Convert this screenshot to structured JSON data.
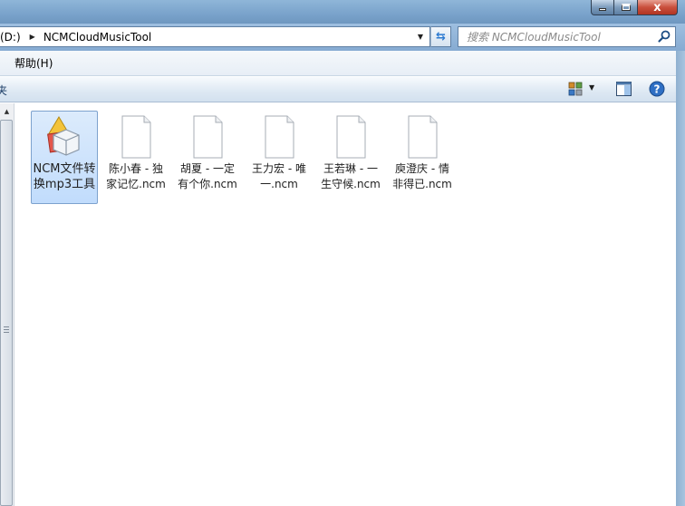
{
  "window": {
    "minimize_label": "",
    "maximize_label": "",
    "close_label": "x"
  },
  "address": {
    "drive": "(D:)",
    "folder": "NCMCloudMusicTool"
  },
  "search": {
    "placeholder": "搜索 NCMCloudMusicTool"
  },
  "menu": {
    "help": "帮助(H)"
  },
  "command": {
    "clipped_label": "夹"
  },
  "files": [
    {
      "label": "NCM文件转换mp3工具",
      "icon": "application-icon",
      "selected": true
    },
    {
      "label": "陈小春 - 独家记忆.ncm",
      "icon": "blank-file-icon",
      "selected": false
    },
    {
      "label": "胡夏 - 一定有个你.ncm",
      "icon": "blank-file-icon",
      "selected": false
    },
    {
      "label": "王力宏 - 唯一.ncm",
      "icon": "blank-file-icon",
      "selected": false
    },
    {
      "label": "王若琳 - 一生守候.ncm",
      "icon": "blank-file-icon",
      "selected": false
    },
    {
      "label": "庾澄庆 - 情非得已.ncm",
      "icon": "blank-file-icon",
      "selected": false
    }
  ],
  "colors": {
    "selection_fill": "#c1dcfc",
    "selection_border": "#7da2ce",
    "close_button": "#c9503d"
  }
}
